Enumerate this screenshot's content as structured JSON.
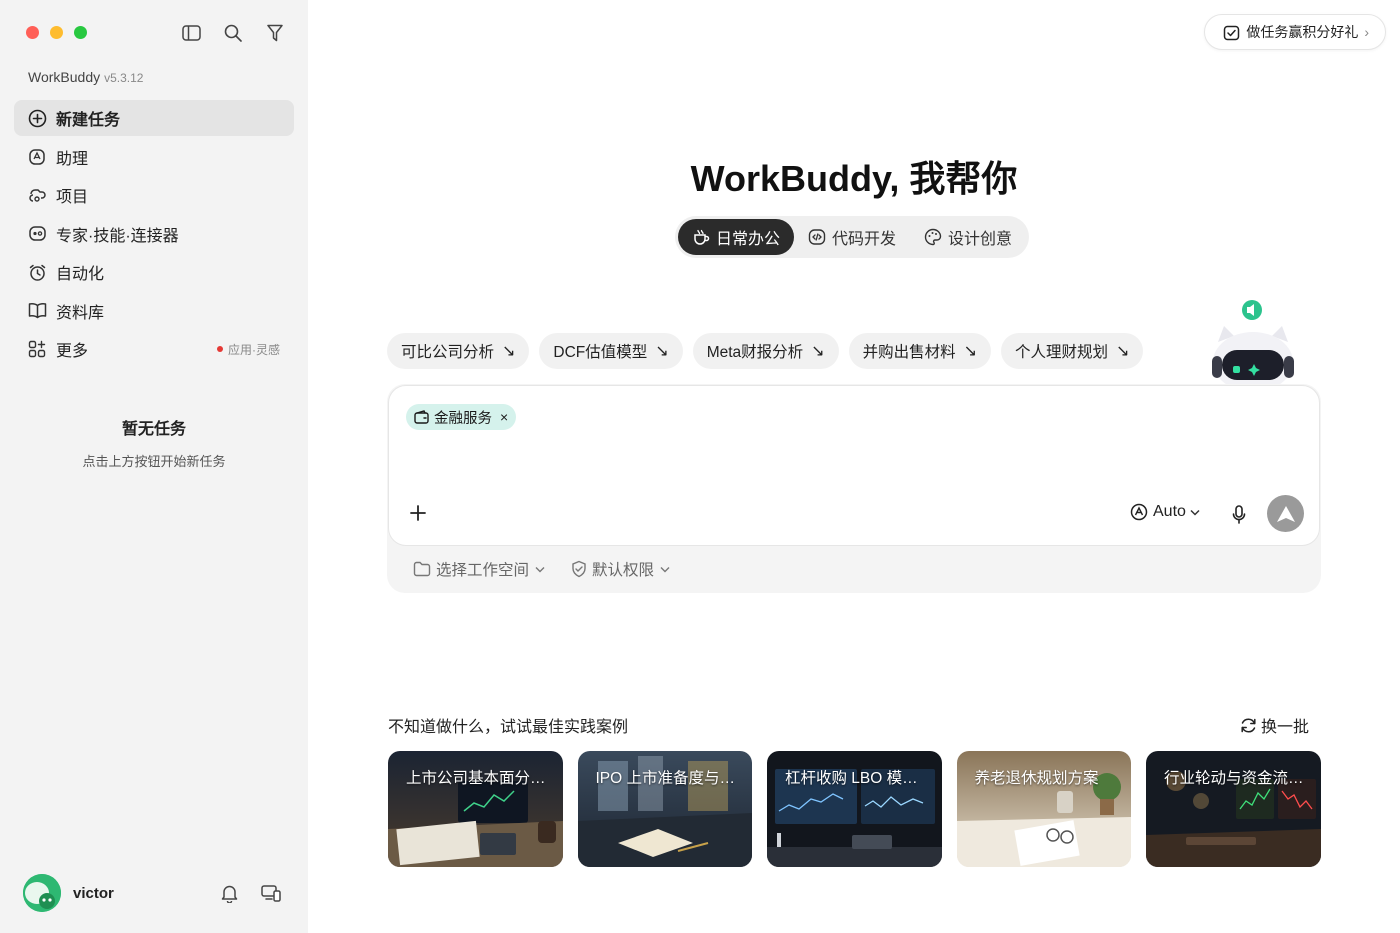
{
  "window": {
    "traffic_colors": [
      "#ff5f57",
      "#febc2e",
      "#28c840"
    ]
  },
  "sidebar": {
    "app_name": "WorkBuddy",
    "version": "v5.3.12",
    "items": [
      {
        "label": "新建任务",
        "icon": "plus-circle-icon"
      },
      {
        "label": "助理",
        "icon": "assistant-icon"
      },
      {
        "label": "项目",
        "icon": "project-icon"
      },
      {
        "label": "专家·技能·连接器",
        "icon": "expert-icon"
      },
      {
        "label": "自动化",
        "icon": "alarm-clock-icon"
      },
      {
        "label": "资料库",
        "icon": "book-icon"
      },
      {
        "label": "更多",
        "icon": "grid-icon",
        "badge": "应用·灵感"
      }
    ],
    "empty_title": "暂无任务",
    "empty_hint": "点击上方按钮开始新任务",
    "user_name": "victor"
  },
  "promo": {
    "label": "做任务赢积分好礼",
    "arrow": "›"
  },
  "hero": {
    "title": "WorkBuddy, 我帮你"
  },
  "modes": [
    {
      "label": "日常办公",
      "icon": "cup-icon",
      "active": true
    },
    {
      "label": "代码开发",
      "icon": "code-icon",
      "active": false
    },
    {
      "label": "设计创意",
      "icon": "palette-icon",
      "active": false
    }
  ],
  "suggestions": [
    {
      "label": "可比公司分析",
      "arrow": "↘"
    },
    {
      "label": "DCF估值模型",
      "arrow": "↘"
    },
    {
      "label": "Meta财报分析",
      "arrow": "↘"
    },
    {
      "label": "并购出售材料",
      "arrow": "↘"
    },
    {
      "label": "个人理财规划",
      "arrow": "↘"
    }
  ],
  "composer": {
    "tag": "金融服务",
    "tag_close": "×",
    "model": "Auto",
    "workspace": "选择工作空间",
    "permission": "默认权限"
  },
  "cases": {
    "title": "不知道做什么，试试最佳实践案例",
    "refresh": "换一批",
    "items": [
      {
        "label": "上市公司基本面分…"
      },
      {
        "label": "IPO 上市准备度与…"
      },
      {
        "label": "杠杆收购 LBO 模…"
      },
      {
        "label": "养老退休规划方案"
      },
      {
        "label": "行业轮动与资金流…"
      }
    ]
  },
  "colors": {
    "accent_dark": "#2b2b2b",
    "tag_bg": "#d5f2ec",
    "sidebar_bg": "#f3f3f3",
    "send_bg": "#9a9a9a"
  }
}
